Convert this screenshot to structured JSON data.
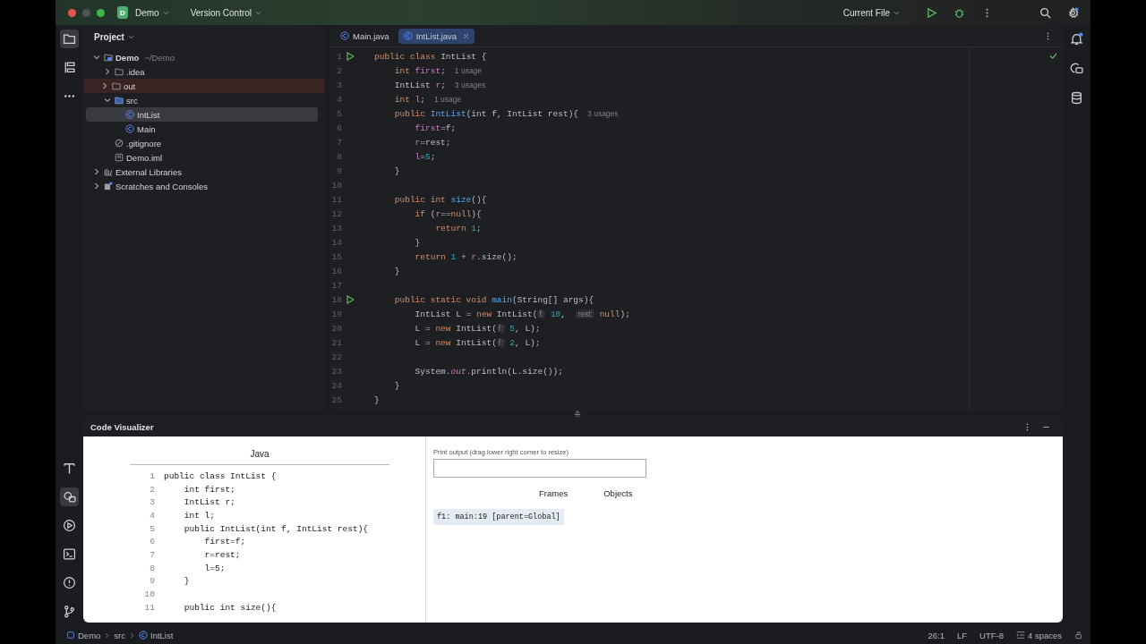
{
  "titlebar": {
    "project_badge": "D",
    "project": "Demo",
    "vcs": "Version Control",
    "run_config": "Current File"
  },
  "project": {
    "title": "Project",
    "tree": [
      {
        "label": "Demo",
        "note": "~/Demo",
        "kind": "module",
        "expanded": true,
        "selected": false,
        "children": [
          {
            "label": ".idea",
            "kind": "folder",
            "expanded": false,
            "selected": false
          },
          {
            "label": "out",
            "kind": "excluded",
            "expanded": false,
            "selected": false
          },
          {
            "label": "src",
            "kind": "source",
            "expanded": true,
            "selected": false,
            "children": [
              {
                "label": "IntList",
                "kind": "class",
                "selected": true
              },
              {
                "label": "Main",
                "kind": "class",
                "selected": false
              }
            ]
          },
          {
            "label": ".gitignore",
            "kind": "ignore",
            "selected": false
          },
          {
            "label": "Demo.iml",
            "kind": "file",
            "selected": false
          }
        ]
      },
      {
        "label": "External Libraries",
        "kind": "library",
        "expanded": false,
        "selected": false
      },
      {
        "label": "Scratches and Consoles",
        "kind": "scratch",
        "expanded": false,
        "selected": false
      }
    ]
  },
  "editor": {
    "tabs": [
      {
        "label": "Main.java",
        "selected": false,
        "closable": false
      },
      {
        "label": "IntList.java",
        "selected": true,
        "closable": true
      }
    ],
    "lines": [
      {
        "n": "1",
        "run": true,
        "tokens": [
          {
            "kind": "kw",
            "text": "public class "
          },
          {
            "kind": "plain",
            "text": "IntList {"
          }
        ]
      },
      {
        "n": "2",
        "tokens": [
          {
            "kind": "kw",
            "text": "    int "
          },
          {
            "kind": "field",
            "text": "first"
          },
          {
            "kind": "plain",
            "text": ";"
          }
        ],
        "usage": "1 usage"
      },
      {
        "n": "3",
        "tokens": [
          {
            "kind": "plain",
            "text": "    IntList "
          },
          {
            "kind": "field",
            "text": "r"
          },
          {
            "kind": "plain",
            "text": ";"
          }
        ],
        "usage": "3 usages"
      },
      {
        "n": "4",
        "tokens": [
          {
            "kind": "kw",
            "text": "    int "
          },
          {
            "kind": "field",
            "text": "l"
          },
          {
            "kind": "plain",
            "text": ";"
          }
        ],
        "usage": "1 usage"
      },
      {
        "n": "5",
        "tokens": [
          {
            "kind": "kw",
            "text": "    public "
          },
          {
            "kind": "fn",
            "text": "IntList"
          },
          {
            "kind": "plain",
            "text": "(int f, IntList rest){"
          }
        ],
        "usage": "3 usages"
      },
      {
        "n": "6",
        "tokens": [
          {
            "kind": "field",
            "text": "        first"
          },
          {
            "kind": "plain",
            "text": "=f;"
          }
        ]
      },
      {
        "n": "7",
        "tokens": [
          {
            "kind": "field",
            "text": "        r"
          },
          {
            "kind": "plain",
            "text": "=rest;"
          }
        ]
      },
      {
        "n": "8",
        "tokens": [
          {
            "kind": "field",
            "text": "        l"
          },
          {
            "kind": "plain",
            "text": "="
          },
          {
            "kind": "num",
            "text": "5"
          },
          {
            "kind": "plain",
            "text": ";"
          }
        ]
      },
      {
        "n": "9",
        "tokens": [
          {
            "kind": "plain",
            "text": "    }"
          }
        ]
      },
      {
        "n": "10"
      },
      {
        "n": "11",
        "tokens": [
          {
            "kind": "kw",
            "text": "    public int "
          },
          {
            "kind": "fn",
            "text": "size"
          },
          {
            "kind": "plain",
            "text": "(){"
          }
        ]
      },
      {
        "n": "12",
        "tokens": [
          {
            "kind": "kw",
            "text": "        if "
          },
          {
            "kind": "plain",
            "text": "("
          },
          {
            "kind": "field",
            "text": "r"
          },
          {
            "kind": "plain",
            "text": "=="
          },
          {
            "kind": "kw",
            "text": "null"
          },
          {
            "kind": "plain",
            "text": "){"
          }
        ]
      },
      {
        "n": "13",
        "tokens": [
          {
            "kind": "kw",
            "text": "            return "
          },
          {
            "kind": "num",
            "text": "1"
          },
          {
            "kind": "plain",
            "text": ";"
          }
        ]
      },
      {
        "n": "14",
        "tokens": [
          {
            "kind": "plain",
            "text": "        }"
          }
        ]
      },
      {
        "n": "15",
        "tokens": [
          {
            "kind": "kw",
            "text": "        return "
          },
          {
            "kind": "num",
            "text": "1"
          },
          {
            "kind": "plain",
            "text": " + "
          },
          {
            "kind": "field",
            "text": "r"
          },
          {
            "kind": "plain",
            "text": ".size();"
          }
        ]
      },
      {
        "n": "16",
        "tokens": [
          {
            "kind": "plain",
            "text": "    }"
          }
        ]
      },
      {
        "n": "17"
      },
      {
        "n": "18",
        "run": true,
        "tokens": [
          {
            "kind": "kw",
            "text": "    public static void "
          },
          {
            "kind": "fn",
            "text": "main"
          },
          {
            "kind": "plain",
            "text": "(String[] args){"
          }
        ]
      },
      {
        "n": "19",
        "tokens": [
          {
            "kind": "plain",
            "text": "        IntList L = "
          },
          {
            "kind": "kw",
            "text": "new "
          },
          {
            "kind": "plain",
            "text": "IntList("
          },
          {
            "kind": "param",
            "text": "f:"
          },
          {
            "kind": "num",
            "text": " 10"
          },
          {
            "kind": "plain",
            "text": ",  "
          },
          {
            "kind": "param",
            "text": "rest:"
          },
          {
            "kind": "kw",
            "text": " null"
          },
          {
            "kind": "plain",
            "text": ");"
          }
        ]
      },
      {
        "n": "20",
        "tokens": [
          {
            "kind": "plain",
            "text": "        L = "
          },
          {
            "kind": "kw",
            "text": "new "
          },
          {
            "kind": "plain",
            "text": "IntList("
          },
          {
            "kind": "param",
            "text": "f:"
          },
          {
            "kind": "num",
            "text": " 5"
          },
          {
            "kind": "plain",
            "text": ", L);"
          }
        ]
      },
      {
        "n": "21",
        "tokens": [
          {
            "kind": "plain",
            "text": "        L = "
          },
          {
            "kind": "kw",
            "text": "new "
          },
          {
            "kind": "plain",
            "text": "IntList("
          },
          {
            "kind": "param",
            "text": "f:"
          },
          {
            "kind": "num",
            "text": " 2"
          },
          {
            "kind": "plain",
            "text": ", L);"
          }
        ]
      },
      {
        "n": "22"
      },
      {
        "n": "23",
        "tokens": [
          {
            "kind": "plain",
            "text": "        System."
          },
          {
            "kind": "static",
            "text": "out"
          },
          {
            "kind": "plain",
            "text": ".println(L.size());"
          }
        ]
      },
      {
        "n": "24",
        "tokens": [
          {
            "kind": "plain",
            "text": "    }"
          }
        ]
      },
      {
        "n": "25",
        "tokens": [
          {
            "kind": "plain",
            "text": "}"
          }
        ]
      }
    ]
  },
  "visualizer": {
    "title": "Code Visualizer",
    "language": "Java",
    "lines": [
      {
        "n": "1",
        "text": "public class IntList {"
      },
      {
        "n": "2",
        "text": "    int first;"
      },
      {
        "n": "3",
        "text": "    IntList r;"
      },
      {
        "n": "4",
        "text": "    int l;"
      },
      {
        "n": "5",
        "text": "    public IntList(int f, IntList rest){"
      },
      {
        "n": "6",
        "text": "        first=f;"
      },
      {
        "n": "7",
        "text": "        r=rest;"
      },
      {
        "n": "8",
        "text": "        l=5;"
      },
      {
        "n": "9",
        "text": "    }"
      },
      {
        "n": "10"
      },
      {
        "n": "11",
        "text": "    public int size(){"
      }
    ],
    "print_output_label": "Print output (drag lower right corner to resize)",
    "frames_heading": "Frames",
    "objects_heading": "Objects",
    "frames": [
      "f1: main:19 [parent=Global]"
    ]
  },
  "status_bar": {
    "breadcrumbs": [
      {
        "label": "Demo",
        "kind": "module"
      },
      {
        "label": "src",
        "kind": "folder"
      },
      {
        "label": "IntList",
        "kind": "class"
      }
    ],
    "position": "26:1",
    "line_ending": "LF",
    "encoding": "UTF-8",
    "indent": "4 spaces"
  }
}
